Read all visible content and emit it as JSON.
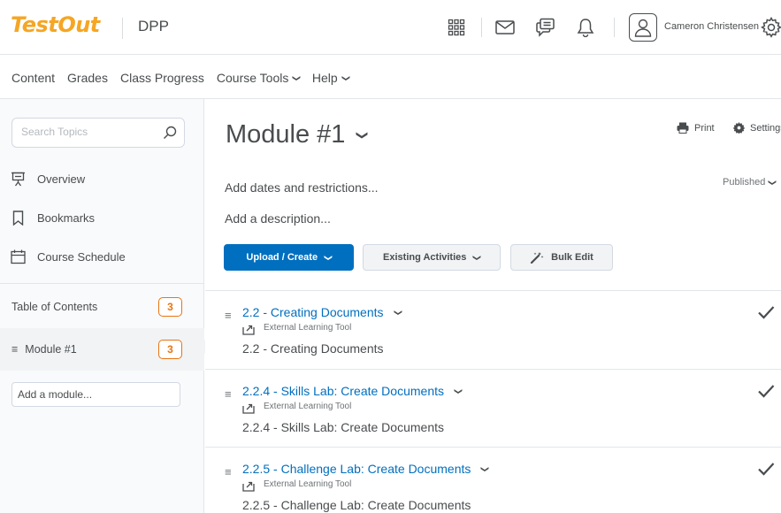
{
  "header": {
    "logo": "TestOut",
    "org_name": "DPP",
    "user_name": "Cameron Christensen",
    "icons": [
      "waffle-icon",
      "mail-icon",
      "chat-icon",
      "bell-icon",
      "user-icon",
      "gear-icon"
    ]
  },
  "nav": {
    "items": [
      {
        "label": "Content",
        "dropdown": false
      },
      {
        "label": "Grades",
        "dropdown": false
      },
      {
        "label": "Class Progress",
        "dropdown": false
      },
      {
        "label": "Course Tools",
        "dropdown": true
      },
      {
        "label": "Help",
        "dropdown": true
      }
    ]
  },
  "sidebar": {
    "search_placeholder": "Search Topics",
    "links": [
      {
        "label": "Overview",
        "icon": "presentation-icon"
      },
      {
        "label": "Bookmarks",
        "icon": "bookmark-icon"
      },
      {
        "label": "Course Schedule",
        "icon": "calendar-icon"
      }
    ],
    "toc_label": "Table of Contents",
    "toc_count": "3",
    "module_label": "Module #1",
    "module_count": "3",
    "add_module_placeholder": "Add a module..."
  },
  "main": {
    "title": "Module #1",
    "print_label": "Print",
    "settings_label": "Settings",
    "dates_label": "Add dates and restrictions...",
    "published_label": "Published",
    "description_label": "Add a description...",
    "upload_label": "Upload / Create",
    "existing_label": "Existing Activities",
    "bulk_label": "Bulk Edit",
    "topics": [
      {
        "title": "2.2 - Creating Documents",
        "type": "External Learning Tool",
        "subtitle": "2.2 - Creating Documents",
        "completed": true
      },
      {
        "title": "2.2.4 - Skills Lab: Create Documents",
        "type": "External Learning Tool",
        "subtitle": "2.2.4 - Skills Lab: Create Documents",
        "completed": true
      },
      {
        "title": "2.2.5 - Challenge Lab: Create Documents",
        "type": "External Learning Tool",
        "subtitle": "2.2.5 - Challenge Lab: Create Documents",
        "completed": true
      }
    ]
  },
  "colors": {
    "primary": "#006fbf",
    "logo": "#f5a623",
    "badge": "#e87511",
    "text": "#494c4e"
  }
}
